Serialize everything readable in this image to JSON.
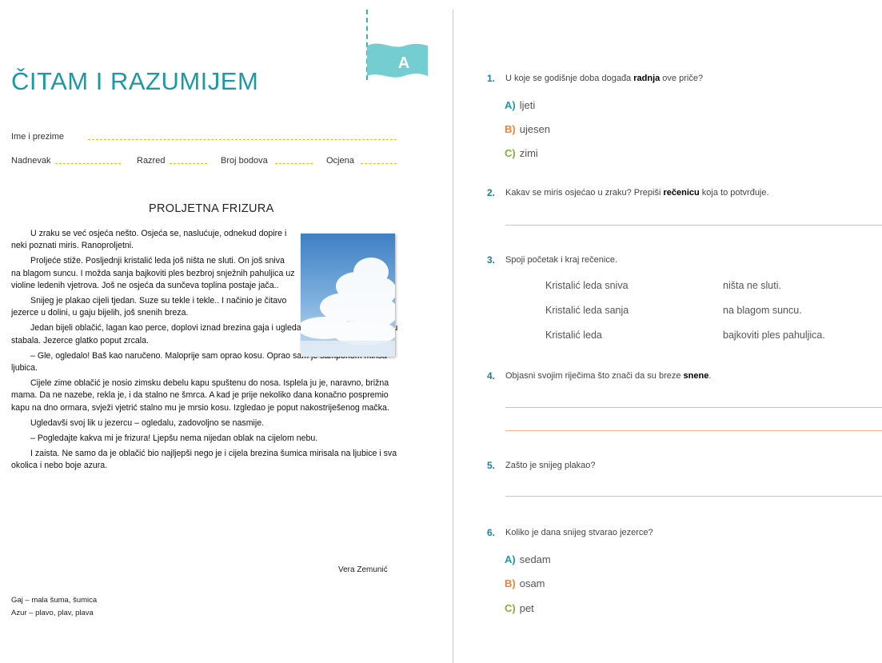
{
  "header": {
    "title": "ČITAM I RAZUMIJEM",
    "badge": "A",
    "name_label": "Ime i prezime",
    "date_label": "Nadnevak",
    "class_label": "Razred",
    "points_label": "Broj bodova",
    "grade_label": "Ocjena"
  },
  "colors": {
    "accent": "#1a9aa4",
    "option_a": "#1d9aa4",
    "option_b": "#ee8233",
    "option_c": "#7ab43a",
    "field_dots": "#f2b51e"
  },
  "story": {
    "title": "PROLJETNA FRIZURA",
    "paragraphs": [
      "U zraku se već osjeća nešto. Osjeća se, naslućuje, odnekud dopire i neki poznati miris. Ranoproljetni.",
      "Proljeće stiže. Posljednji kristalić leda još ništa ne sluti. On još sniva na blagom suncu. I možda sanja bajkoviti ples bezbroj snježnih pahuljica uz violine ledenih vjetrova. Još ne osjeća da sunčeva toplina postaje jača..",
      "Snijeg je plakao cijeli tjedan. Suze su tekle i tekle.. I načinio je čitavo jezerce u dolini, u gaju bijelih, još snenih breza.",
      "Jedan bijeli oblačić, lagan kao perce, doplovi iznad brezina gaja i ugleda bistro jezerce u podnožju stabala. Jezerce glatko poput zrcala.",
      "– Gle, ogledalo! Baš kao naručeno. Maloprije sam oprao kosu. Oprao sam je šamponom mirisa ljubica.",
      "Cijele zime oblačić je nosio zimsku debelu kapu spuštenu do nosa. Isplela ju je, naravno, brižna mama. Da ne nazebe, rekla je, i da stalno ne šmrca. A kad je prije nekoliko dana konačno pospremio kapu na dno ormara, svježi vjetrić stalno mu je mrsio kosu. Izgledao je poput nakostriješenog mačka.",
      "Ugledavši svoj lik u jezercu – ogledalu, zadovoljno se nasmije.",
      "– Pogledajte kakva mi je frizura! Ljepšu nema nijedan oblak na cijelom nebu.",
      "I zaista. Ne samo da je oblačić bio najljepši nego je i cijela brezina šumica mirisala na ljubice i sva okolica i nebo boje azura."
    ],
    "author": "Vera Zemunić",
    "glossary": [
      "Gaj – mala šuma, šumica",
      "Azur – plavo, plav, plava"
    ]
  },
  "questions": [
    {
      "num": "1.",
      "pre": "U koje se godišnje doba događa ",
      "bold": "radnja",
      "post": " ove priče?",
      "options": [
        {
          "letter": "A)",
          "text": "ljeti"
        },
        {
          "letter": "B)",
          "text": "ujesen"
        },
        {
          "letter": "C)",
          "text": "zimi"
        }
      ]
    },
    {
      "num": "2.",
      "pre": "Kakav se miris osjećao u zraku? Prepiši ",
      "bold": "rečenicu",
      "post": " koja to potvrđuje."
    },
    {
      "num": "3.",
      "text": "Spoji početak i kraj rečenice.",
      "left": [
        "Kristalić leda sniva",
        "Kristalić leda sanja",
        "Kristalić leda"
      ],
      "right": [
        "ništa ne sluti.",
        "na blagom suncu.",
        "bajkoviti ples pahuljica."
      ]
    },
    {
      "num": "4.",
      "pre": "Objasni svojim riječima što znači da su breze ",
      "bold": "snene",
      "post": "."
    },
    {
      "num": "5.",
      "text": "Zašto je snijeg plakao?"
    },
    {
      "num": "6.",
      "text": "Koliko je dana snijeg stvarao jezerce?",
      "options": [
        {
          "letter": "A)",
          "text": "sedam"
        },
        {
          "letter": "B)",
          "text": "osam"
        },
        {
          "letter": "C)",
          "text": "pet"
        }
      ]
    }
  ]
}
